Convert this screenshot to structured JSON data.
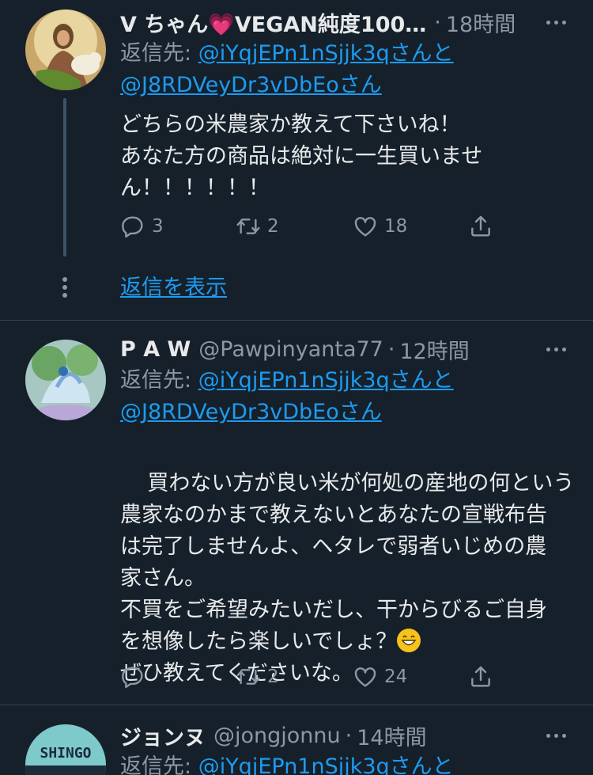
{
  "tweets": [
    {
      "name": "V ちゃん💗VEGAN純度100…",
      "handle": "",
      "time": "18時間",
      "reply_prefix": "返信先: ",
      "reply_to_1": "@iYqjEPn1nSjjk3qさんと",
      "reply_to_2": "@J8RDVeyDr3vDbEoさん",
      "text": "どちらの米農家か教えて下さいね！\nあなた方の商品は絶対に一生買いませ\nん！！！！！！",
      "replies": "3",
      "retweets": "2",
      "likes": "18",
      "show_replies": "返信を表示"
    },
    {
      "name": "P A W",
      "handle": "@Pawpinyanta77",
      "time": "12時間",
      "reply_prefix": "返信先: ",
      "reply_to_1": "@iYqjEPn1nSjjk3qさんと",
      "reply_to_2": "@J8RDVeyDr3vDbEoさん",
      "text_1": "買わない方が良い米が何処の産地の何という\n農家なのかまで教えないとあなたの宣戦布告\nは完了しませんよ、ヘタレで弱者いじめの農\n家さん。\n不買をご希望みたいだし、干からびるご自身\nを想像したら楽しいでしょ？",
      "text_2": "\nぜひ教えてくださいな。",
      "replies": "",
      "retweets": "2",
      "likes": "24"
    },
    {
      "name": "ジョンヌ",
      "handle": "@jongjonnu",
      "time": "14時間",
      "reply_prefix": "返信先: ",
      "reply_to_1": "@iYqjEPn1nSjjk3qさんと",
      "avatar_text": "SHINGO"
    }
  ],
  "separator": "·",
  "icons": {
    "reply": "reply-icon",
    "retweet": "retweet-icon",
    "like": "heart-icon",
    "share": "share-icon",
    "more": "more-icon"
  },
  "colors": {
    "background": "#15202b",
    "link": "#1d9bf0",
    "muted": "#8b98a5",
    "text": "#e7e9ea"
  }
}
